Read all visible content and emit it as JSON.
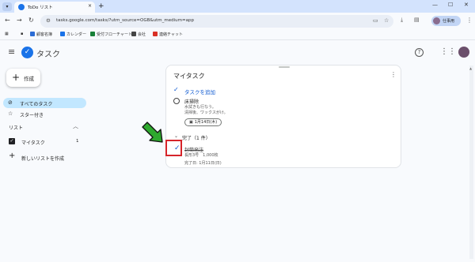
{
  "browser": {
    "tab_title": "ToDo リスト",
    "url": "tasks.google.com/tasks/?utm_source=OGB&utm_medium=app",
    "profile_label": "仕事用"
  },
  "bookmarks": [
    {
      "label": "顧客名簿",
      "color": "#2b6cd4"
    },
    {
      "label": "カレンダー",
      "color": "#1a73e8"
    },
    {
      "label": "受付フローチャート",
      "color": "#188038"
    },
    {
      "label": "会社",
      "color": "#444444"
    },
    {
      "label": "連絡チャット",
      "color": "#d93025"
    }
  ],
  "app": {
    "title": "タスク"
  },
  "sidebar": {
    "create_label": "作成",
    "nav": [
      {
        "label": "すべてのタスク",
        "icon": "check-circle-icon",
        "active": true
      },
      {
        "label": "スター付き",
        "icon": "star-icon",
        "active": false
      }
    ],
    "lists_heading": "リスト",
    "lists": [
      {
        "label": "マイタスク",
        "count": "1",
        "checked": true
      }
    ],
    "new_list_label": "新しいリストを作成"
  },
  "card": {
    "title": "マイタスク",
    "add_task_label": "タスクを追加",
    "tasks": [
      {
        "title": "床掃除",
        "description_line1": "水拭きも行なう。",
        "description_line2": "清掃後、ワックスがけ。",
        "date": "1月14日(木)"
      }
    ],
    "completed_heading": "完了（1 件）",
    "completed": [
      {
        "title": "封筒発注",
        "description": "長形3号　1,000枚",
        "completed_date": "完了日: 1月11日(日)"
      }
    ]
  },
  "colors": {
    "accent": "#0b57d0",
    "active_nav": "#c2e7ff",
    "highlight_box": "#d6242a",
    "arrow": "#2ea92e"
  }
}
